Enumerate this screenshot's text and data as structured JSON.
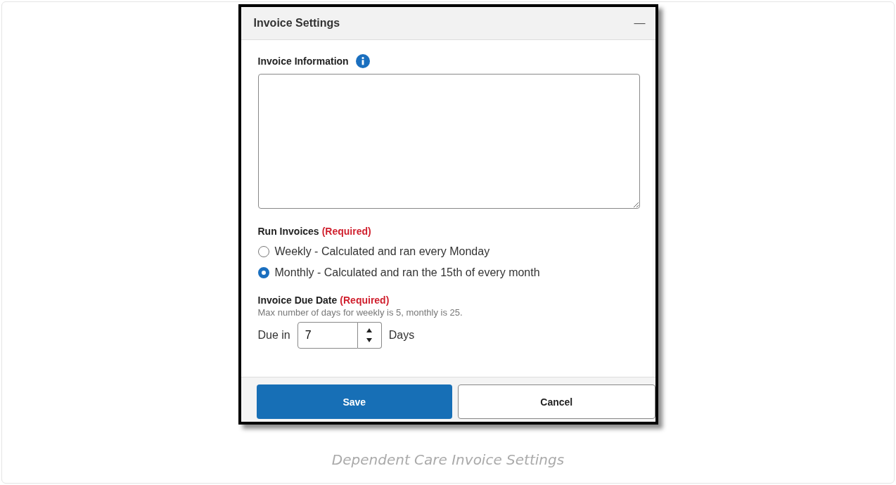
{
  "panel": {
    "title": "Invoice Settings",
    "collapse_symbol": "—"
  },
  "invoice_information": {
    "label": "Invoice Information"
  },
  "run_invoices": {
    "label": "Run Invoices",
    "required": "(Required)",
    "options": [
      {
        "label": "Weekly - Calculated and ran every Monday",
        "selected": false
      },
      {
        "label": "Monthly - Calculated and ran the 15th of every month",
        "selected": true
      }
    ]
  },
  "due_date": {
    "label": "Invoice Due Date",
    "required": "(Required)",
    "hint": "Max number of days for weekly is 5, monthly is 25.",
    "prefix": "Due in",
    "value": "7",
    "suffix": "Days"
  },
  "buttons": [
    {
      "label": "Save",
      "kind": "primary"
    },
    {
      "label": "Cancel",
      "kind": "secondary"
    }
  ],
  "caption": "Dependent Care Invoice Settings"
}
